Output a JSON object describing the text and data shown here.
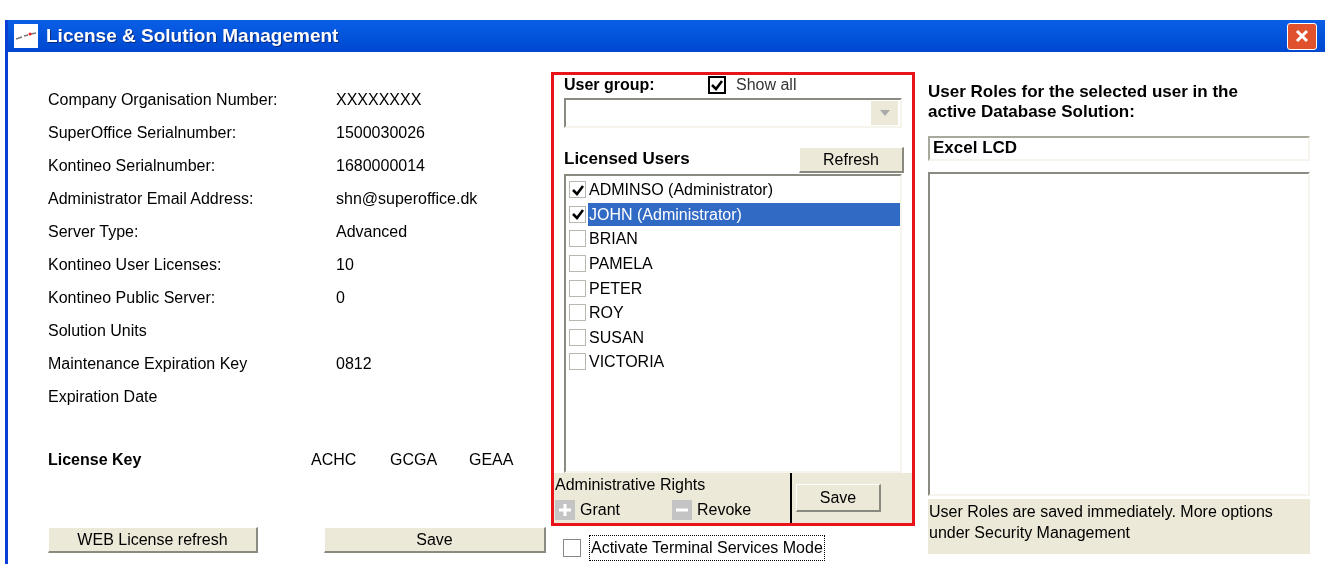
{
  "window": {
    "title": "License & Solution Management"
  },
  "details": [
    {
      "label": "Company Organisation Number:",
      "value": "XXXXXXXX"
    },
    {
      "label": "SuperOffice Serialnumber:",
      "value": "1500030026"
    },
    {
      "label": "Kontineo Serialnumber:",
      "value": "1680000014"
    },
    {
      "label": "Administrator Email Address:",
      "value": "shn@superoffice.dk"
    },
    {
      "label": "Server Type:",
      "value": "Advanced"
    },
    {
      "label": "Kontineo User Licenses:",
      "value": "10"
    },
    {
      "label": "Kontineo Public Server:",
      "value": "0"
    },
    {
      "label": "Solution Units"
    },
    {
      "label": "Maintenance Expiration Key",
      "value": "0812"
    },
    {
      "label": "Expiration Date"
    }
  ],
  "license_key": {
    "label": "License Key",
    "parts": [
      "ACHC",
      "GCGA",
      "GEAA"
    ]
  },
  "left_buttons": [
    "WEB License refresh",
    "Save"
  ],
  "user_group": {
    "label": "User group:",
    "show_all": {
      "label": "Show all",
      "checked": true
    }
  },
  "licensed_users": {
    "title": "Licensed Users",
    "refresh_button": "Refresh",
    "users": [
      {
        "name": "ADMINSO (Administrator)",
        "checked": true,
        "selected": false
      },
      {
        "name": "JOHN (Administrator)",
        "checked": true,
        "selected": true
      },
      {
        "name": "BRIAN",
        "checked": false,
        "selected": false
      },
      {
        "name": "PAMELA",
        "checked": false,
        "selected": false
      },
      {
        "name": "PETER",
        "checked": false,
        "selected": false
      },
      {
        "name": "ROY",
        "checked": false,
        "selected": false
      },
      {
        "name": "SUSAN",
        "checked": false,
        "selected": false
      },
      {
        "name": "VICTORIA",
        "checked": false,
        "selected": false
      }
    ]
  },
  "admin_rights": {
    "title": "Administrative Rights",
    "grant": "Grant",
    "revoke": "Revoke",
    "save_button": "Save"
  },
  "terminal_services": {
    "label": "Activate Terminal Services Mode",
    "checked": false,
    "focused": true
  },
  "roles": {
    "heading": "User Roles for the selected user in the active Database Solution:",
    "solution": "Excel LCD",
    "note": "User Roles are saved immediately. More options under Security Management"
  }
}
